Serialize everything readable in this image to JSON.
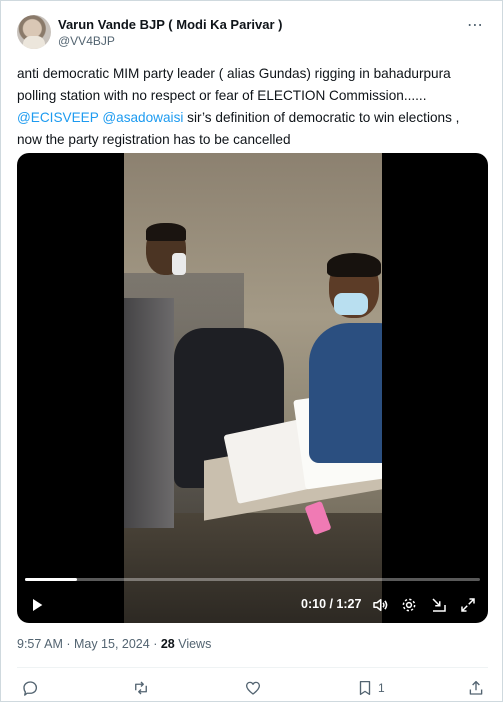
{
  "tweet": {
    "author_name": "Varun Vande BJP ( Modi Ka Parivar )",
    "author_handle": "@VV4BJP",
    "text_line1": "anti democratic MIM party leader ( alias Gundas) rigging in bahadurpura",
    "text_line2": "polling station with no respect or fear of ELECTION Commission......",
    "mention1": "@ECISVEEP",
    "mention2": "@asadowaisi",
    "text_line3_rest": " sir’s definition of democratic to win elections ,",
    "text_line4": "now the party registration has to be cancelled",
    "timestamp": "9:57 AM · May 15, 2024 · ",
    "views_count": "28",
    "views_label": " Views"
  },
  "video": {
    "time_display": "0:10 / 1:27",
    "progress_fraction": 0.115
  },
  "actions": {
    "bookmark_count": "1"
  },
  "icons": [
    "more-icon",
    "play-icon",
    "volume-icon",
    "settings-icon",
    "dock-icon",
    "fullscreen-icon",
    "reply-icon",
    "retweet-icon",
    "like-icon",
    "bookmark-icon",
    "share-icon"
  ],
  "colors": {
    "link": "#1d9bf0",
    "secondary_text": "#536471",
    "primary_text": "#0f1419"
  }
}
